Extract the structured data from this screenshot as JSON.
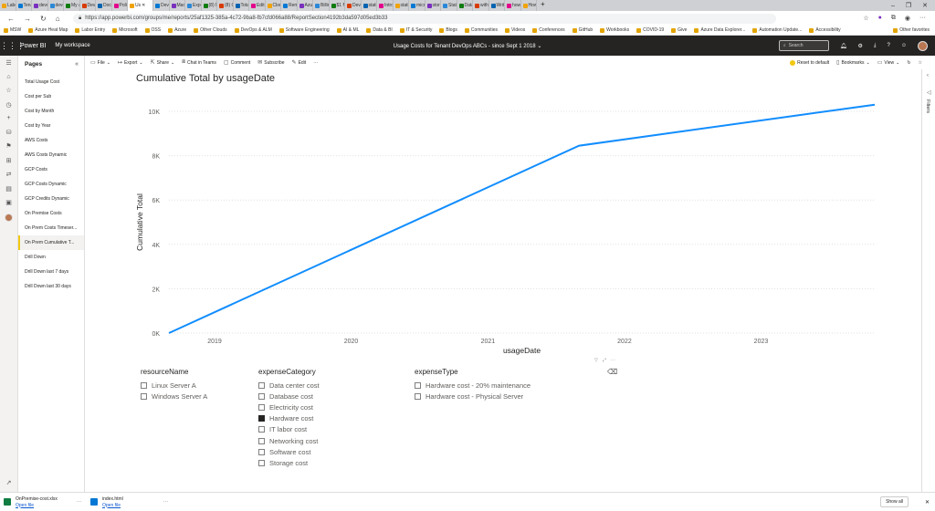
{
  "browser": {
    "tabs": [
      "Labo",
      "Tenan",
      "devo",
      "devo",
      "My a",
      "DevO",
      "Docu",
      "Polic",
      "Us",
      "DevO",
      "Mana",
      "Expe",
      "(8) M",
      "(8) C",
      "Totals",
      "Edit R",
      "Cloud",
      "Reme",
      "Azure",
      "Billing",
      "$1 M",
      "DevO",
      "static",
      "Introd",
      "static",
      "micro",
      "stora",
      "Static",
      "Data",
      "witho",
      "Write",
      "how t",
      "How t"
    ],
    "active_tab_index": 8,
    "new_tab": "+",
    "url": "https://app.powerbi.com/groups/me/reports/25af1325-385a-4c72-9ba8-fb7cfd066a88/ReportSection4192b3da597d05ed3b33",
    "bookmarks": [
      "MSW",
      "Azure Heat Map",
      "Labor Entry",
      "Microsoft",
      "OSS",
      "Azure",
      "Other Clouds",
      "DevOps & ALM",
      "Software Engineering",
      "AI & ML",
      "Data & BI",
      "IT & Security",
      "Blogs",
      "Communities",
      "Videos",
      "Conferences",
      "GitHub",
      "Workbooks",
      "COVID-19",
      "Give",
      "Azure Data Explorer...",
      "Automation Update...",
      "Accessibility"
    ],
    "other_favorites": "Other favorites"
  },
  "powerbi": {
    "brand": "Power BI",
    "workspace": "My workspace",
    "report_title": "Usage Costs for Tenant DevOps ABCs - since Sept 1 2018",
    "search_placeholder": "Search"
  },
  "pages_panel": {
    "title": "Pages",
    "items": [
      "Total Usage Cost",
      "Cost per Sub",
      "Cost by Month",
      "Cost by Year",
      "AWS Costs",
      "AWS Costs Dynamic",
      "GCP Costs",
      "GCP Costs Dynamic",
      "GCP Credits Dynamic",
      "On Premise Costs",
      "On Prem Costs Timeser...",
      "On Prem Cumulative T...",
      "Drill Down",
      "Drill Down last 7 days",
      "Drill Down last 30 days"
    ],
    "active_index": 11
  },
  "toolbar": {
    "file": "File",
    "export": "Export",
    "share": "Share",
    "teams": "Chat in Teams",
    "comment": "Comment",
    "subscribe": "Subscribe",
    "edit": "Edit",
    "more": "···",
    "reset": "Reset to default",
    "bookmarks": "Bookmarks",
    "view": "View"
  },
  "filters_label": "Filters",
  "chart_data": {
    "type": "line",
    "title": "Cumulative Total by usageDate",
    "xlabel": "usageDate",
    "ylabel": "Cumulative Total",
    "x_ticks": [
      "2019",
      "2020",
      "2021",
      "2022",
      "2023"
    ],
    "y_ticks": [
      "0K",
      "2K",
      "4K",
      "6K",
      "8K",
      "10K"
    ],
    "ylim": [
      0,
      10000
    ],
    "xlim": [
      "2018-09-01",
      "2023-11-01"
    ],
    "grid": true,
    "series": [
      {
        "color": "#118dff",
        "points": [
          {
            "x": "2018-09-01",
            "y": 0
          },
          {
            "x": "2021-09-01",
            "y": 8450
          },
          {
            "x": "2023-11-01",
            "y": 10300
          }
        ]
      }
    ]
  },
  "slicers": [
    {
      "title": "resourceName",
      "options": [
        {
          "label": "Linux Server A",
          "checked": false
        },
        {
          "label": "Windows Server A",
          "checked": false
        }
      ]
    },
    {
      "title": "expenseCategory",
      "options": [
        {
          "label": "Data center cost",
          "checked": false
        },
        {
          "label": "Database cost",
          "checked": false
        },
        {
          "label": "Electricity cost",
          "checked": false
        },
        {
          "label": "Hardware cost",
          "checked": true
        },
        {
          "label": "IT labor cost",
          "checked": false
        },
        {
          "label": "Networking cost",
          "checked": false
        },
        {
          "label": "Software cost",
          "checked": false
        },
        {
          "label": "Storage cost",
          "checked": false
        }
      ]
    },
    {
      "title": "expenseType",
      "options": [
        {
          "label": "Hardware cost - 20% maintenance",
          "checked": false
        },
        {
          "label": "Hardware cost - Physical Server",
          "checked": false
        }
      ]
    }
  ],
  "downloads": {
    "items": [
      {
        "name": "OnPremise-cost.xlsx",
        "link": "Open file"
      },
      {
        "name": "index.html",
        "link": "Open file"
      }
    ],
    "show_all": "Show all"
  }
}
